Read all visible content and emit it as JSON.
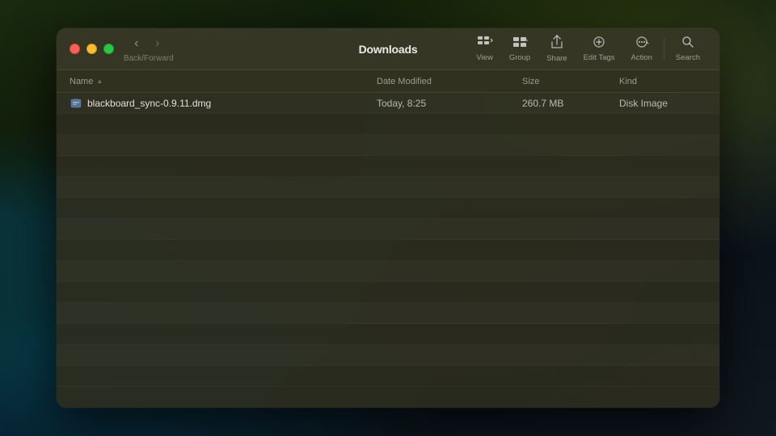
{
  "window": {
    "title": "Downloads"
  },
  "traffic_lights": {
    "close_label": "close",
    "minimize_label": "minimize",
    "maximize_label": "maximize"
  },
  "nav": {
    "back_label": "‹",
    "forward_label": "›",
    "back_forward_label": "Back/Forward"
  },
  "toolbar": {
    "view_label": "View",
    "group_label": "Group",
    "share_label": "Share",
    "edit_tags_label": "Edit Tags",
    "action_label": "Action",
    "search_label": "Search"
  },
  "columns": {
    "name": "Name",
    "date_modified": "Date Modified",
    "size": "Size",
    "kind": "Kind"
  },
  "files": [
    {
      "name": "blackboard_sync-0.9.11.dmg",
      "date_modified": "Today, 8:25",
      "size": "260.7 MB",
      "kind": "Disk Image",
      "type": "dmg"
    }
  ]
}
